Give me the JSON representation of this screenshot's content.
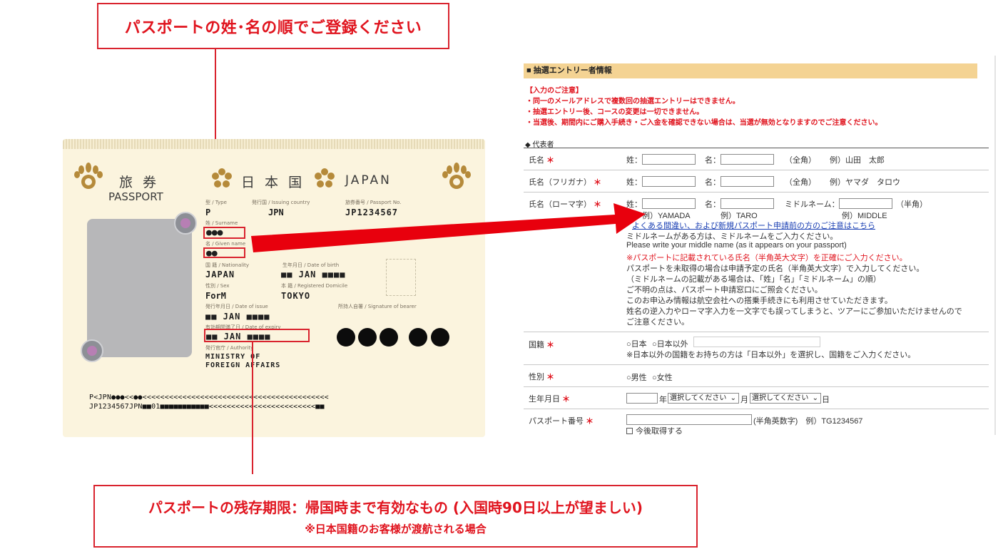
{
  "callouts": {
    "top": "パスポートの姓･名の順でご登録ください",
    "bottom_line1": "パスポートの残存期限：帰国時まで有効なもの (入国時90日以上が望ましい)",
    "bottom_line2": "※日本国籍のお客様が渡航される場合"
  },
  "passport": {
    "title_jp": "旅 券",
    "title_en": "PASSPORT",
    "country_jp": "日 本 国",
    "country_en": "JAPAN",
    "labels": {
      "type": "型 / Type",
      "issuing_country": "発行国 / Issuing country",
      "passport_no": "旅券番号 / Passport No.",
      "surname": "姓 / Surname",
      "given_name": "名 / Given name",
      "nationality": "国 籍 / Nationality",
      "dob": "生年月日 / Date of birth",
      "sex": "性別 / Sex",
      "domicile": "本 籍 / Registered Domicile",
      "date_of_issue": "発行年月日 / Date of issue",
      "signature": "所持人自署 / Signature of bearer",
      "date_of_expiry": "有効期間満了日 / Date of expiry",
      "authority": "発行官庁 / Authority"
    },
    "values": {
      "type": "P",
      "issuing_country": "JPN",
      "passport_no": "JP1234567",
      "surname": "●●●",
      "given_name": "●●",
      "nationality": "JAPAN",
      "dob": "■■ JAN ■■■■",
      "sex": "ForM",
      "domicile": "TOKYO",
      "date_of_issue": "■■ JAN ■■■■",
      "date_of_expiry": "■■ JAN ■■■■",
      "authority_line1": "MINISTRY OF",
      "authority_line2": "FOREIGN AFFAIRS",
      "signature": "●●● ●●"
    },
    "mrz": {
      "line1": "P<JPN●●●<<●●<<<<<<<<<<<<<<<<<<<<<<<<<<<<<<<<<<<<<<<<<<",
      "line2": "JP1234567JPN■■01■■■■■■■■■■■<<<<<<<<<<<<<<<<<<<<<<<<■■"
    }
  },
  "form": {
    "section_title": "■ 抽選エントリー者情報",
    "notes": [
      "【入力のご注意】",
      "・同一のメールアドレスで複数回の抽選エントリーはできません。",
      "・抽選エントリー後、コースの変更は一切できません。",
      "・当選後、期間内にご購入手続き・ご入金を確認できない場合は、当選が無効となりますのでご注意ください。"
    ],
    "representative_label": "◆ 代表者",
    "required_mark": "＊",
    "rows": {
      "name": {
        "label": "氏名",
        "sei": "姓：",
        "mei": "名：",
        "note": "（全角）",
        "example": "例）山田　太郎"
      },
      "kana": {
        "label": "氏名（フリガナ）",
        "sei": "姓：",
        "mei": "名：",
        "note": "（全角）",
        "example": "例）ヤマダ　タロウ"
      },
      "roman": {
        "label": "氏名（ローマ字）",
        "sei": "姓：",
        "mei": "名：",
        "middle": "ミドルネーム：",
        "half": "（半角）",
        "ex_sei": "例）YAMADA",
        "ex_mei": "例）TARO",
        "ex_middle": "例）MIDDLE",
        "link": "よくある間違い、および新規パスポート申請前の方のご注意はこちら",
        "lines": [
          "ミドルネームがある方は、ミドルネームをご入力ください。",
          "Please write your middle name (as it appears on your passport)"
        ],
        "red_line": "※パスポートに記載されている氏名（半角英大文字）を正確にご入力ください。",
        "more_lines": [
          "パスポートを未取得の場合は申請予定の氏名（半角英大文字）で入力してください。",
          "（ミドルネームの記載がある場合は、「姓」「名」「ミドルネーム」の順）",
          "ご不明の点は、パスポート申請窓口にご照会ください。",
          "このお申込み情報は航空会社への搭乗手続きにも利用させていただきます。",
          "姓名の逆入力やローマ字入力を一文字でも誤ってしまうと、ツアーにご参加いただけませんので",
          "ご注意ください。"
        ]
      },
      "nationality": {
        "label": "国籍",
        "opt1": "○日本",
        "opt2": "○日本以外",
        "note": "※日本以外の国籍をお持ちの方は「日本以外」を選択し、国籍をご入力ください。"
      },
      "sex": {
        "label": "性別",
        "opt1": "○男性",
        "opt2": "○女性"
      },
      "dob": {
        "label": "生年月日",
        "year": "年",
        "month_select": "選択してください",
        "month": "月",
        "day_select": "選択してください",
        "day": "日"
      },
      "passport": {
        "label": "パスポート番号",
        "note": "(半角英数字)　例）TG1234567",
        "checkbox": "今後取得する"
      }
    }
  }
}
